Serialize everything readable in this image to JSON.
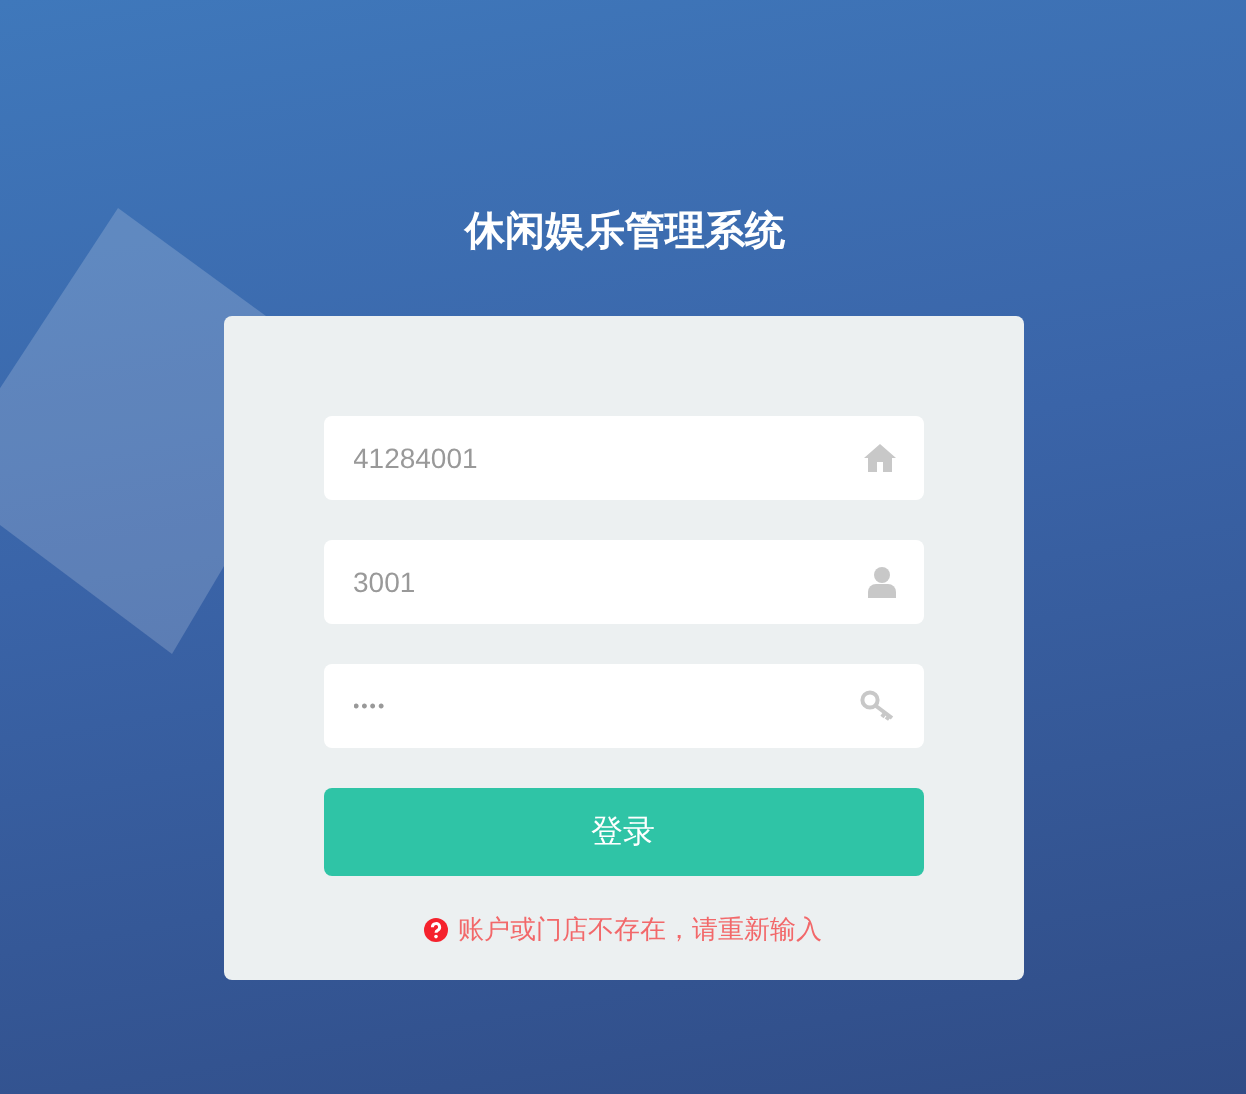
{
  "title": "休闲娱乐管理系统",
  "fields": [
    {
      "kind": "store",
      "value": "41284001"
    },
    {
      "kind": "user",
      "value": "3001"
    },
    {
      "kind": "password",
      "value": "••••"
    }
  ],
  "login_button": "登录",
  "error": "账户或门店不存在，请重新输入"
}
